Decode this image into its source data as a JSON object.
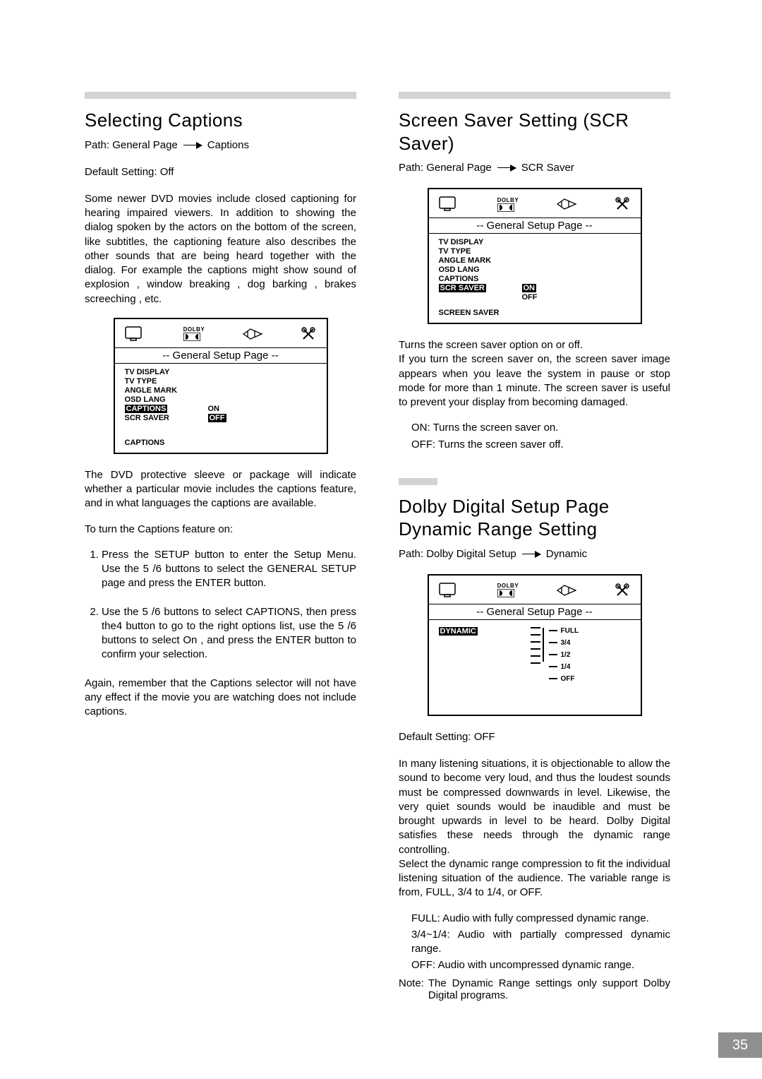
{
  "page_number": "35",
  "left": {
    "heading": "Selecting Captions",
    "path_prefix": "Path: General Page",
    "path_suffix": "Captions",
    "default": "Default Setting: Off",
    "intro": "Some newer DVD movies include closed captioning for hearing impaired viewers. In addition to showing the dialog spoken by the actors on the bottom of the screen, like subtitles, the captioning feature also describes the other sounds that are being heard together with the dialog. For example the captions might show  sound of explosion ,  window breaking ,  dog barking ,  brakes screeching , etc.",
    "osd": {
      "title": "-- General  Setup  Page --",
      "menu": [
        "TV DISPLAY",
        "TV TYPE",
        "ANGLE MARK",
        "OSD LANG",
        "CAPTIONS",
        "SCR SAVER"
      ],
      "selected": "CAPTIONS",
      "options": [
        "ON",
        "OFF"
      ],
      "opt_selected": "OFF",
      "footer": "CAPTIONS"
    },
    "after_osd": "The DVD protective sleeve or package will indicate whether a particular movie includes the captions feature, and in what languages the captions are available.",
    "toturn": "To turn the Captions feature on:",
    "step1": "Press the SETUP button to enter the Setup Menu. Use the 5 /6  buttons to select the GENERAL SETUP page and press the ENTER button.",
    "step2": "Use the 5 /6  buttons to select CAPTIONS, then press the4 button to go to the right options list, use the 5 /6 buttons to select  On , and press the ENTER button to confirm your selection.",
    "closing": "Again, remember that the Captions selector will not have any effect if the movie you are watching does not include captions."
  },
  "right1": {
    "heading": "Screen Saver Setting (SCR Saver)",
    "path_prefix": "Path: General Page",
    "path_suffix": "SCR Saver",
    "osd": {
      "title": "-- General  Setup  Page --",
      "menu": [
        "TV DISPLAY",
        "TV TYPE",
        "ANGLE MARK",
        "OSD LANG",
        "CAPTIONS",
        "SCR SAVER"
      ],
      "selected": "SCR SAVER",
      "options": [
        "ON",
        "OFF"
      ],
      "opt_selected": "ON",
      "footer": "SCREEN SAVER"
    },
    "p1": "Turns the screen saver option on or off.",
    "p2": "If you turn the screen saver on, the screen saver image appears when you leave the system in pause or stop mode for more than 1 minute. The screen saver is useful to prevent your display from becoming damaged.",
    "on": "ON: Turns the screen saver on.",
    "off": "OFF: Turns the screen saver off."
  },
  "right2": {
    "heading": "Dolby Digital Setup Page Dynamic Range Setting",
    "path_prefix": "Path: Dolby Digital Setup",
    "path_suffix": "Dynamic",
    "osd": {
      "title": "-- General  Setup  Page --",
      "selected": "DYNAMIC",
      "labels": [
        "FULL",
        "3/4",
        "1/2",
        "1/4",
        "OFF"
      ]
    },
    "default": "Default Setting: OFF",
    "p1": "In many listening situations, it is objectionable to allow the sound to become very loud, and thus the loudest sounds must be compressed downwards in level. Likewise, the very quiet sounds would be inaudible and must be brought upwards in level to be heard. Dolby Digital satisfies these needs through the dynamic range controlling.",
    "p2": "Select the dynamic range compression to fit the individual listening situation of the audience. The variable range is from, FULL, 3/4 to 1/4, or OFF.",
    "full": "FULL: Audio with fully compressed dynamic range.",
    "mid": "3/4~1/4: Audio with partially compressed dynamic range.",
    "off": "OFF: Audio with uncompressed dynamic range.",
    "note_label": "Note:",
    "note_body": "The Dynamic Range settings only support Dolby Digital programs."
  },
  "icons": {
    "dolby_label": "DOLBY"
  }
}
